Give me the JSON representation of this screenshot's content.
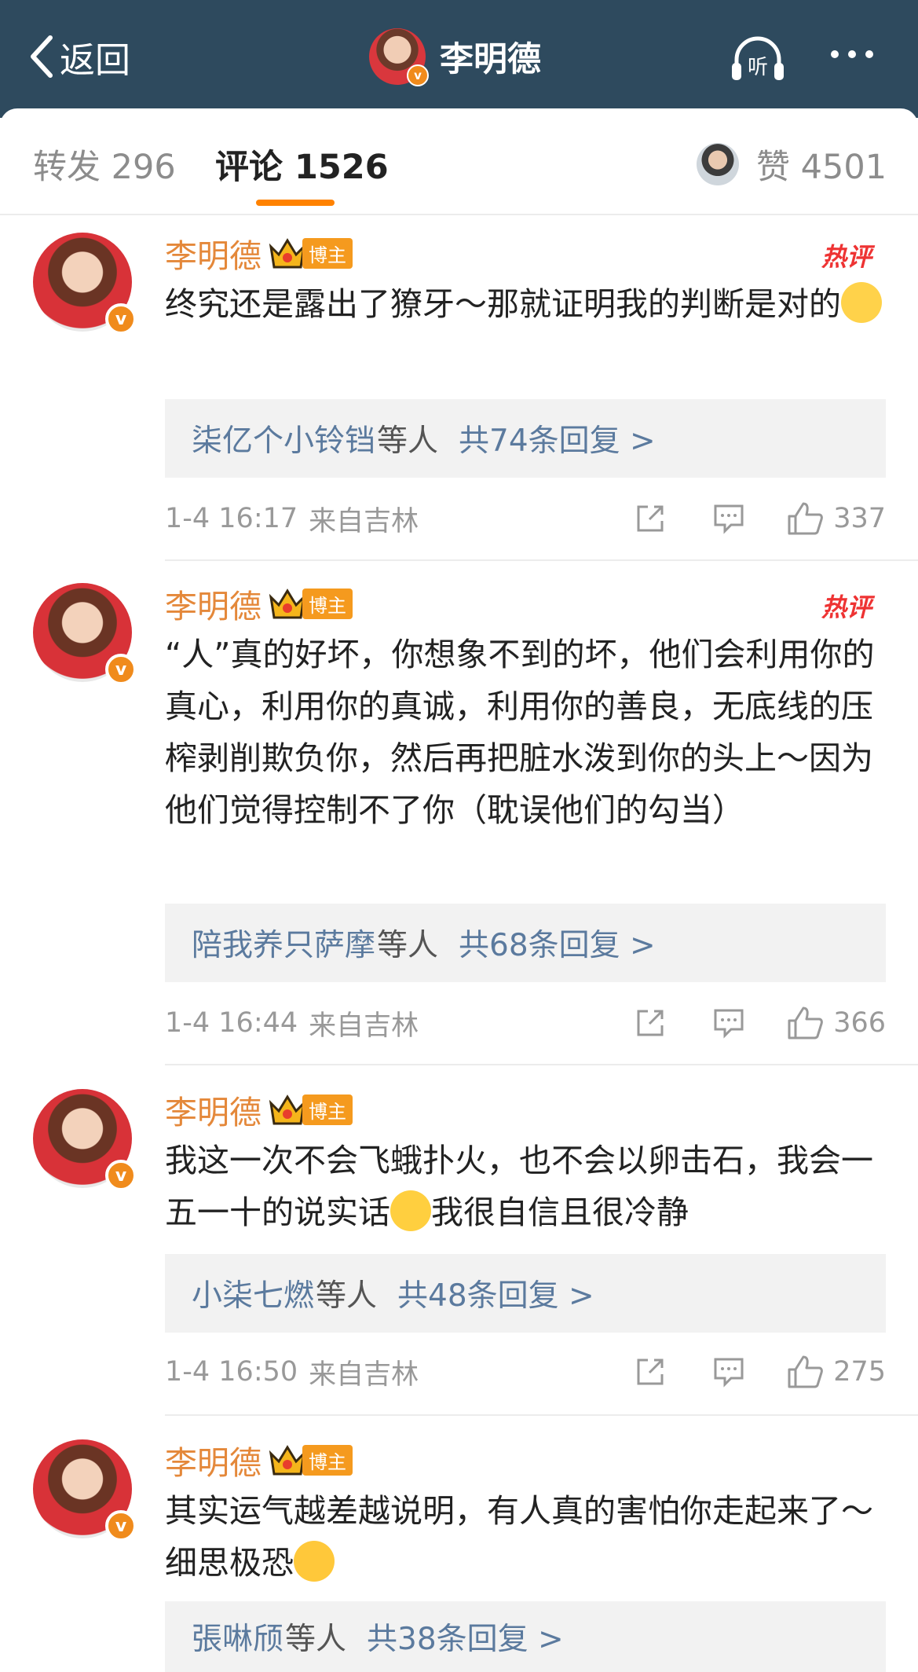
{
  "header": {
    "back_label": "返回",
    "title": "李明德",
    "listen_label": "听"
  },
  "tabs": {
    "repost": "转发 296",
    "comment": "评论 1526",
    "likes": "赞 4501",
    "accent_color": "#ff8200"
  },
  "comments": [
    {
      "name": "李明德",
      "badge": "博主",
      "hot": "热评",
      "text": "终究还是露出了獠牙～那就证明我的判断是对的",
      "emoji": "glasses-emoji",
      "reply_names": "柒亿个小铃铛",
      "reply_etc": "等人",
      "reply_count": "共74条回复 >",
      "time": "1-4 16:17",
      "source": "来自吉林",
      "likes": "337"
    },
    {
      "name": "李明德",
      "badge": "博主",
      "hot": "热评",
      "text": "“人”真的好坏，你想象不到的坏，他们会利用你的真心，利用你的真诚，利用你的善良，无底线的压榨剥削欺负你，然后再把脏水泼到你的头上～因为他们觉得控制不了你（耽误他们的勾当）",
      "reply_names": "陪我养只萨摩",
      "reply_etc": "等人",
      "reply_count": "共68条回复 >",
      "time": "1-4 16:44",
      "source": "来自吉林",
      "likes": "366"
    },
    {
      "name": "李明德",
      "badge": "博主",
      "text_a": "我这一次不会飞蛾扑火，也不会以卵击石，我会一五一十的说实话",
      "text_b": "我很自信且很冷静",
      "emoji": "smile-emoji",
      "reply_names": "小柒七燃",
      "reply_etc": "等人",
      "reply_count": "共48条回复 >",
      "time": "1-4 16:50",
      "source": "来自吉林",
      "likes": "275"
    },
    {
      "name": "李明德",
      "badge": "博主",
      "text": "其实运气越差越说明，有人真的害怕你走起来了～细思极恐",
      "emoji": "scared-emoji",
      "reply_names": "張啉颀",
      "reply_etc": "等人",
      "reply_count": "共38条回复 >"
    }
  ],
  "verified_mark": "v",
  "colors": {
    "header_bg": "#2e4a5e",
    "name": "#e4883a",
    "link": "#5b7a9e"
  }
}
